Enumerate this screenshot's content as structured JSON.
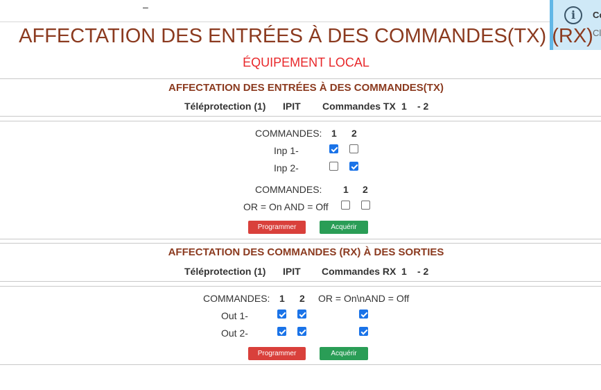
{
  "topbar": {
    "dash": "–"
  },
  "toast": {
    "title": "Co",
    "text": "Cl"
  },
  "page": {
    "title": "AFFECTATION DES ENTRÉES À DES COMMANDES(TX) (RX)",
    "subtitle": "ÉQUIPEMENT LOCAL"
  },
  "tx": {
    "title": "AFFECTATION DES ENTRÉES À DES COMMANDES(TX)",
    "info": {
      "teleprotection": "Téléprotection (1)",
      "ipit": "IPIT",
      "commands": "Commandes TX",
      "range_start": "1",
      "range_end": "- 2"
    },
    "commands_label": "COMMANDES:",
    "cmd1": "1",
    "cmd2": "2",
    "rows": [
      {
        "label": "Inp 1-",
        "c1": true,
        "c2": false
      },
      {
        "label": "Inp 2-",
        "c1": false,
        "c2": true
      }
    ],
    "logic": {
      "commands_label": "COMMANDES:",
      "cmd1": "1",
      "cmd2": "2",
      "label": "OR = On AND = Off",
      "c1": false,
      "c2": false
    },
    "program_button": "Programmer",
    "acquire_button": "Acquérir"
  },
  "rx": {
    "title": "AFFECTATION DES COMMANDES (RX) À DES SORTIES",
    "info": {
      "teleprotection": "Téléprotection (1)",
      "ipit": "IPIT",
      "commands": "Commandes RX",
      "range_start": "1",
      "range_end": "- 2"
    },
    "commands_label": "COMMANDES:",
    "cmd1": "1",
    "cmd2": "2",
    "logic_label": "OR = On\\nAND = Off",
    "rows": [
      {
        "label": "Out 1-",
        "c1": true,
        "c2": true,
        "logic": true
      },
      {
        "label": "Out 2-",
        "c1": true,
        "c2": true,
        "logic": true
      }
    ],
    "program_button": "Programmer",
    "acquire_button": "Acquérir"
  }
}
